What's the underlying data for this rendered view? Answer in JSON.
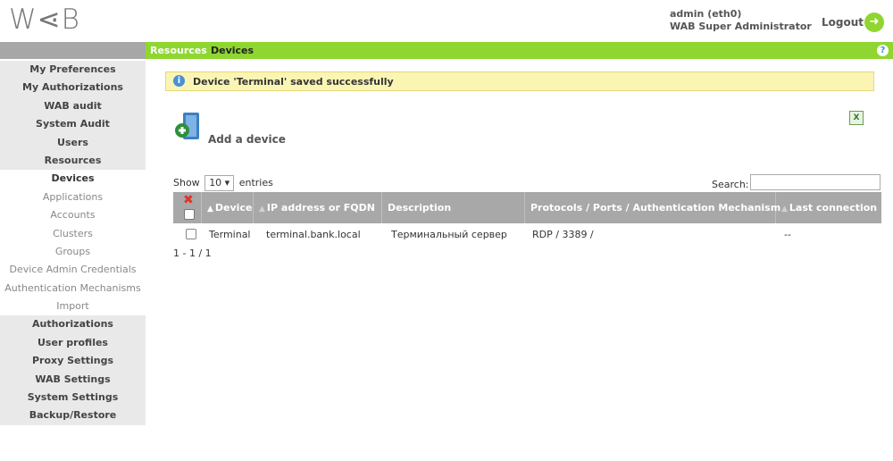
{
  "header": {
    "logo_text": "W⋖B",
    "user": "admin (eth0)",
    "role": "WAB Super Administrator",
    "logout_label": "Logout",
    "logout_icon": "logout-arrow-icon"
  },
  "breadcrumb": {
    "parent": "Resources",
    "current": "Devices",
    "help_icon": "help-icon"
  },
  "sidebar": {
    "items": [
      {
        "label": "My Preferences",
        "kind": "section"
      },
      {
        "label": "My Authorizations",
        "kind": "section"
      },
      {
        "label": "WAB audit",
        "kind": "section"
      },
      {
        "label": "System Audit",
        "kind": "section"
      },
      {
        "label": "Users",
        "kind": "section"
      },
      {
        "label": "Resources",
        "kind": "section"
      },
      {
        "label": "Devices",
        "kind": "active"
      },
      {
        "label": "Applications",
        "kind": "sub"
      },
      {
        "label": "Accounts",
        "kind": "sub"
      },
      {
        "label": "Clusters",
        "kind": "sub"
      },
      {
        "label": "Groups",
        "kind": "sub"
      },
      {
        "label": "Device Admin Credentials",
        "kind": "sub"
      },
      {
        "label": "Authentication Mechanisms",
        "kind": "sub"
      },
      {
        "label": "Import",
        "kind": "sub"
      },
      {
        "label": "Authorizations",
        "kind": "section"
      },
      {
        "label": "User profiles",
        "kind": "section"
      },
      {
        "label": "Proxy Settings",
        "kind": "section"
      },
      {
        "label": "WAB Settings",
        "kind": "section"
      },
      {
        "label": "System Settings",
        "kind": "section"
      },
      {
        "label": "Backup/Restore",
        "kind": "section"
      }
    ]
  },
  "notice": {
    "text": "Device 'Terminal' saved successfully",
    "icon": "info-icon"
  },
  "actions": {
    "add_device_label": "Add a device",
    "export_icon": "excel-export-icon"
  },
  "table_controls": {
    "show_label": "Show",
    "entries_value": "10",
    "entries_label": "entries",
    "search_label": "Search:",
    "search_value": ""
  },
  "table": {
    "columns": [
      "Device",
      "IP address or FQDN",
      "Description",
      "Protocols / Ports / Authentication Mechanism",
      "Last connection"
    ],
    "rows": [
      {
        "device": "Terminal",
        "ip": "terminal.bank.local",
        "description": "Терминальный сервер",
        "protocols": "RDP / 3389 /",
        "last_connection": "--"
      }
    ],
    "pagination": "1 - 1 / 1"
  },
  "colors": {
    "accent_green": "#8fd631",
    "nav_grey": "#a7a7a7",
    "notice_bg": "#fbf5b4",
    "delete_red": "#e0332a"
  }
}
